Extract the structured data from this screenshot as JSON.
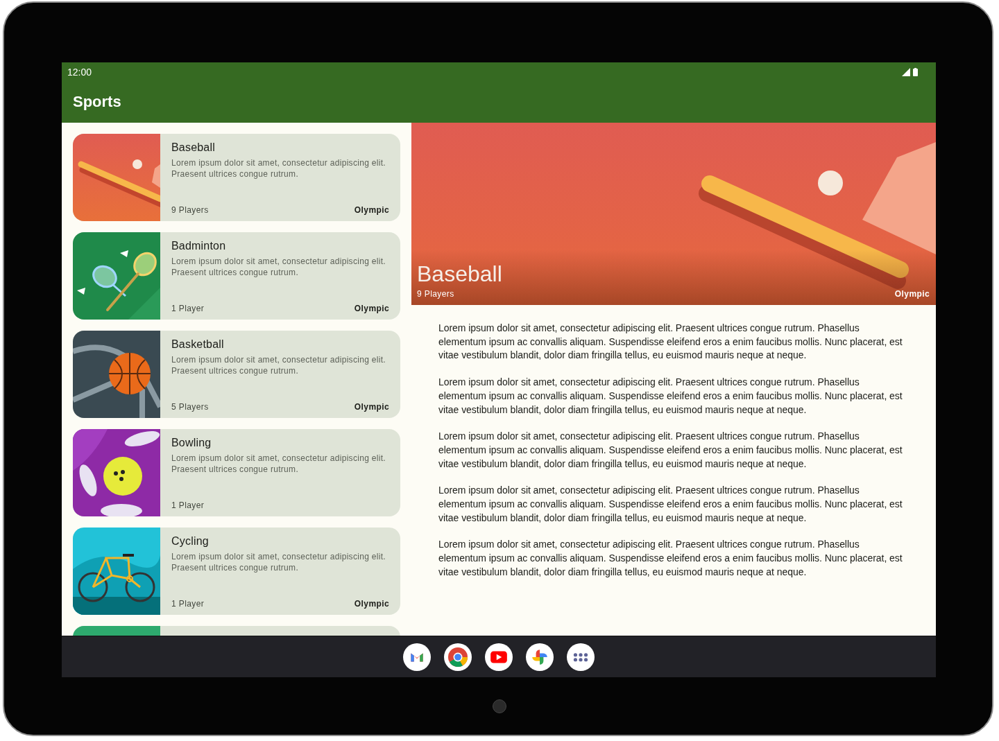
{
  "status_bar": {
    "time": "12:00"
  },
  "app_bar": {
    "title": "Sports"
  },
  "sports": [
    {
      "kind": "baseball",
      "name": "Baseball",
      "description": "Lorem ipsum dolor sit amet, consectetur adipiscing elit. Praesent ultrices congue rutrum.",
      "players": "9 Players",
      "tag": "Olympic"
    },
    {
      "kind": "badminton",
      "name": "Badminton",
      "description": "Lorem ipsum dolor sit amet, consectetur adipiscing elit. Praesent ultrices congue rutrum.",
      "players": "1 Player",
      "tag": "Olympic"
    },
    {
      "kind": "basketball",
      "name": "Basketball",
      "description": "Lorem ipsum dolor sit amet, consectetur adipiscing elit. Praesent ultrices congue rutrum.",
      "players": "5 Players",
      "tag": "Olympic"
    },
    {
      "kind": "bowling",
      "name": "Bowling",
      "description": "Lorem ipsum dolor sit amet, consectetur adipiscing elit. Praesent ultrices congue rutrum.",
      "players": "1 Player"
    },
    {
      "kind": "cycling",
      "name": "Cycling",
      "description": "Lorem ipsum dolor sit amet, consectetur adipiscing elit. Praesent ultrices congue rutrum.",
      "players": "1 Player",
      "tag": "Olympic"
    },
    {
      "kind": "golf"
    }
  ],
  "detail": {
    "kind": "baseball",
    "title": "Baseball",
    "players": "9 Players",
    "tag": "Olympic",
    "paragraphs": [
      "Lorem ipsum dolor sit amet, consectetur adipiscing elit. Praesent ultrices congue rutrum. Phasellus elementum ipsum ac convallis aliquam. Suspendisse eleifend eros a enim faucibus mollis. Nunc placerat, est vitae vestibulum blandit, dolor diam fringilla tellus, eu euismod mauris neque at neque.",
      "Lorem ipsum dolor sit amet, consectetur adipiscing elit. Praesent ultrices congue rutrum. Phasellus elementum ipsum ac convallis aliquam. Suspendisse eleifend eros a enim faucibus mollis. Nunc placerat, est vitae vestibulum blandit, dolor diam fringilla tellus, eu euismod mauris neque at neque.",
      "Lorem ipsum dolor sit amet, consectetur adipiscing elit. Praesent ultrices congue rutrum. Phasellus elementum ipsum ac convallis aliquam. Suspendisse eleifend eros a enim faucibus mollis. Nunc placerat, est vitae vestibulum blandit, dolor diam fringilla tellus, eu euismod mauris neque at neque.",
      "Lorem ipsum dolor sit amet, consectetur adipiscing elit. Praesent ultrices congue rutrum. Phasellus elementum ipsum ac convallis aliquam. Suspendisse eleifend eros a enim faucibus mollis. Nunc placerat, est vitae vestibulum blandit, dolor diam fringilla tellus, eu euismod mauris neque at neque.",
      "Lorem ipsum dolor sit amet, consectetur adipiscing elit. Praesent ultrices congue rutrum. Phasellus elementum ipsum ac convallis aliquam. Suspendisse eleifend eros a enim faucibus mollis. Nunc placerat, est vitae vestibulum blandit, dolor diam fringilla tellus, eu euismod mauris neque at neque."
    ]
  },
  "taskbar": {
    "apps": [
      {
        "kind": "mail"
      },
      {
        "kind": "browser"
      },
      {
        "kind": "video"
      },
      {
        "kind": "photos"
      },
      {
        "kind": "apps"
      }
    ]
  }
}
